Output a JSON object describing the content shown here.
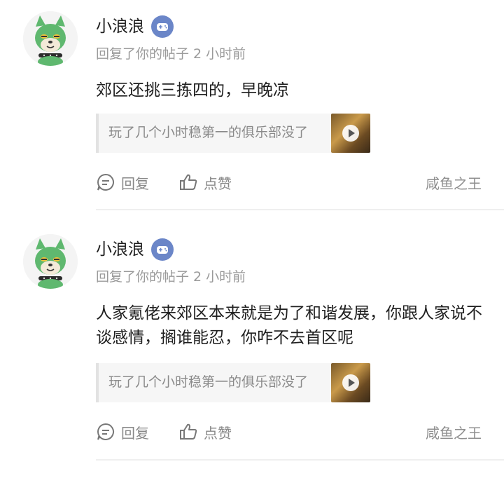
{
  "comments": [
    {
      "username": "小浪浪",
      "badge_icon": "gamepad-badge-icon",
      "meta": "回复了你的帖子 2 小时前",
      "content": "郊区还挑三拣四的，早晚凉",
      "quote_text": "玩了几个小时稳第一的俱乐部没了",
      "reply_label": "回复",
      "like_label": "点赞",
      "circle_name": "咸鱼之王"
    },
    {
      "username": "小浪浪",
      "badge_icon": "gamepad-badge-icon",
      "meta": "回复了你的帖子 2 小时前",
      "content": "人家氪佬来郊区本来就是为了和谐发展，你跟人家说不谈感情，搁谁能忍，你咋不去首区呢",
      "quote_text": "玩了几个小时稳第一的俱乐部没了",
      "reply_label": "回复",
      "like_label": "点赞",
      "circle_name": "咸鱼之王"
    }
  ],
  "colors": {
    "avatar_fur": "#5fb86f",
    "badge": "#6b86c8",
    "muted_text": "#9a9a9a",
    "divider": "#efefef"
  }
}
